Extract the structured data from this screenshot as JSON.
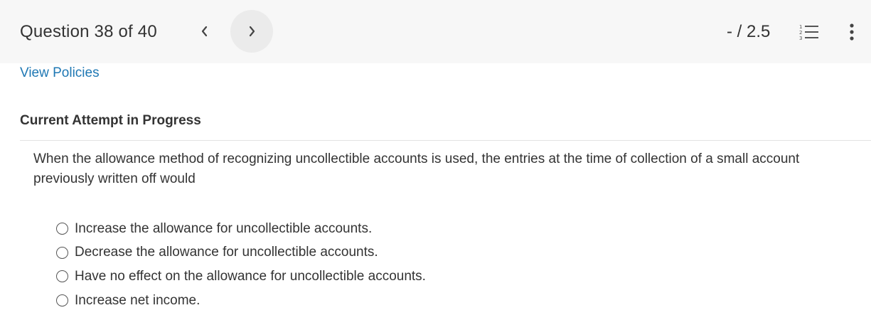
{
  "header": {
    "question_counter": "Question 38 of 40",
    "prev_icon": "chevron-left-icon",
    "next_icon": "chevron-right-icon",
    "score": "- / 2.5",
    "list_icon": "numbered-list-icon",
    "more_icon": "more-vertical-icon"
  },
  "links": {
    "view_policies": "View Policies"
  },
  "attempt": {
    "status": "Current Attempt in Progress"
  },
  "question": {
    "text": "When the allowance method of recognizing uncollectible accounts is used, the entries at the time of collection of a small account previously written off would",
    "options": [
      {
        "label": "Increase the allowance for uncollectible accounts."
      },
      {
        "label": "Decrease the allowance for uncollectible accounts."
      },
      {
        "label": "Have no effect on the allowance for uncollectible accounts."
      },
      {
        "label": "Increase net income."
      }
    ]
  },
  "colors": {
    "link": "#1f78b4",
    "header_bg": "#f7f7f7",
    "next_button_bg": "#ebebeb"
  }
}
